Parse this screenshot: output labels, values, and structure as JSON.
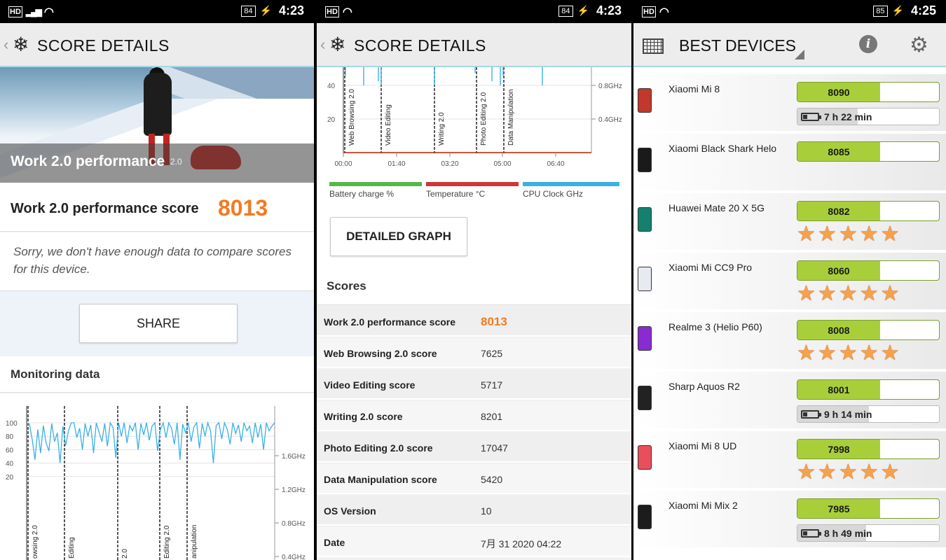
{
  "status": [
    {
      "hd": "HD",
      "battery": "84",
      "time": "4:23"
    },
    {
      "hd": "HD",
      "battery": "84",
      "time": "4:23"
    },
    {
      "hd": "HD",
      "battery": "85",
      "time": "4:25"
    }
  ],
  "icons": {
    "back": "chevron-left-icon",
    "logo": "snowflake-icon",
    "grid": "grid-icon",
    "info": "info-icon",
    "gear": "gear-icon"
  },
  "colors": {
    "accent": "#f47a20",
    "score_bar": "#a8cf3a",
    "battery_line": "#55b747",
    "temp_line": "#d13535",
    "cpu_line": "#3bb0e6",
    "star": "#f5a24a"
  },
  "panel1": {
    "title": "SCORE DETAILS",
    "hero_title": "Work 2.0 performance",
    "hero_badge": "2.0",
    "score_label": "Work 2.0 performance score",
    "score_value": "8013",
    "note": "Sorry, we don't have enough data to compare scores for this device.",
    "share_label": "SHARE",
    "monitoring_label": "Monitoring data"
  },
  "panel2": {
    "title": "SCORE DETAILS",
    "legend": [
      "Battery charge %",
      "Temperature °C",
      "CPU Clock GHz"
    ],
    "detailed_graph_label": "DETAILED GRAPH",
    "scores_heading": "Scores",
    "rows": [
      {
        "label": "Work 2.0 performance score",
        "value": "8013"
      },
      {
        "label": "Web Browsing 2.0 score",
        "value": "7625"
      },
      {
        "label": "Video Editing score",
        "value": "5717"
      },
      {
        "label": "Writing 2.0 score",
        "value": "8201"
      },
      {
        "label": "Photo Editing 2.0 score",
        "value": "17047"
      },
      {
        "label": "Data Manipulation score",
        "value": "5420"
      },
      {
        "label": "OS Version",
        "value": "10"
      },
      {
        "label": "Date",
        "value": "7月 31 2020 04:22"
      }
    ]
  },
  "chart_data": [
    {
      "type": "line",
      "yticks": [
        "100",
        "80",
        "60",
        "40",
        "20"
      ],
      "right_ticks": [
        "1.6GHz",
        "1.2GHz",
        "0.8GHz",
        "0.4GHz"
      ],
      "segments": [
        "owsing 2.0",
        "Editing",
        "2.0",
        "Editing 2.0",
        "anipulation"
      ],
      "series": [
        {
          "values": [
            100,
            98,
            75,
            45,
            90,
            55,
            96,
            70,
            58,
            99,
            72,
            85,
            40,
            95,
            66,
            88,
            100,
            100,
            78,
            92,
            60,
            99,
            80,
            97,
            55,
            100,
            86,
            72,
            99,
            65,
            100,
            93,
            48,
            100,
            80,
            100,
            70,
            96,
            88,
            100,
            60,
            99,
            82,
            100,
            74,
            95,
            100,
            58,
            90,
            100,
            78,
            100,
            92,
            68,
            100,
            45,
            98,
            85,
            100,
            72,
            94,
            100,
            62,
            99,
            80,
            100,
            88,
            40,
            96,
            100,
            76,
            100,
            90,
            68,
            100,
            84,
            97,
            72,
            100,
            88,
            95,
            70,
            100,
            78,
            98,
            60,
            100,
            88,
            95,
            100
          ]
        }
      ]
    },
    {
      "type": "line",
      "yticks": [
        "40",
        "20"
      ],
      "right_ticks": [
        "0.8GHz",
        "0.4GHz"
      ],
      "xticks": [
        "00:00",
        "01:40",
        "03:20",
        "05:00",
        "06:40"
      ],
      "segments": [
        "Web Browsing 2.0",
        "Video Editing",
        "Writing 2.0",
        "Photo Editing 2.0",
        "Data Manipulation"
      ]
    }
  ],
  "panel3": {
    "title": "BEST DEVICES",
    "devices": [
      {
        "name": "Xiaomi Mi 8",
        "score": "8090",
        "battery": "7 h 22 min",
        "battery_fraction": 0.42,
        "phone_color": "#c0392b"
      },
      {
        "name": "Xiaomi Black Shark Helo",
        "score": "8085",
        "battery": "",
        "battery_fraction": 0,
        "phone_color": "#1a1a1a"
      },
      {
        "name": "Huawei Mate 20 X 5G",
        "score": "8082",
        "stars": 5,
        "phone_color": "#16806f"
      },
      {
        "name": "Xiaomi Mi CC9 Pro",
        "score": "8060",
        "stars": 5,
        "phone_color": "#e8eaf2"
      },
      {
        "name": "Realme 3 (Helio P60)",
        "score": "8008",
        "stars": 5,
        "phone_color": "#8a2bd1"
      },
      {
        "name": "Sharp Aquos R2",
        "score": "8001",
        "battery": "9 h 14 min",
        "battery_fraction": 0.5,
        "phone_color": "#222222"
      },
      {
        "name": "Xiaomi Mi 8 UD",
        "score": "7998",
        "stars": 5,
        "phone_color": "#e84f5c"
      },
      {
        "name": "Xiaomi Mi Mix 2",
        "score": "7985",
        "battery": "8 h 49 min",
        "battery_fraction": 0.48,
        "phone_color": "#1c1c1c"
      }
    ]
  }
}
